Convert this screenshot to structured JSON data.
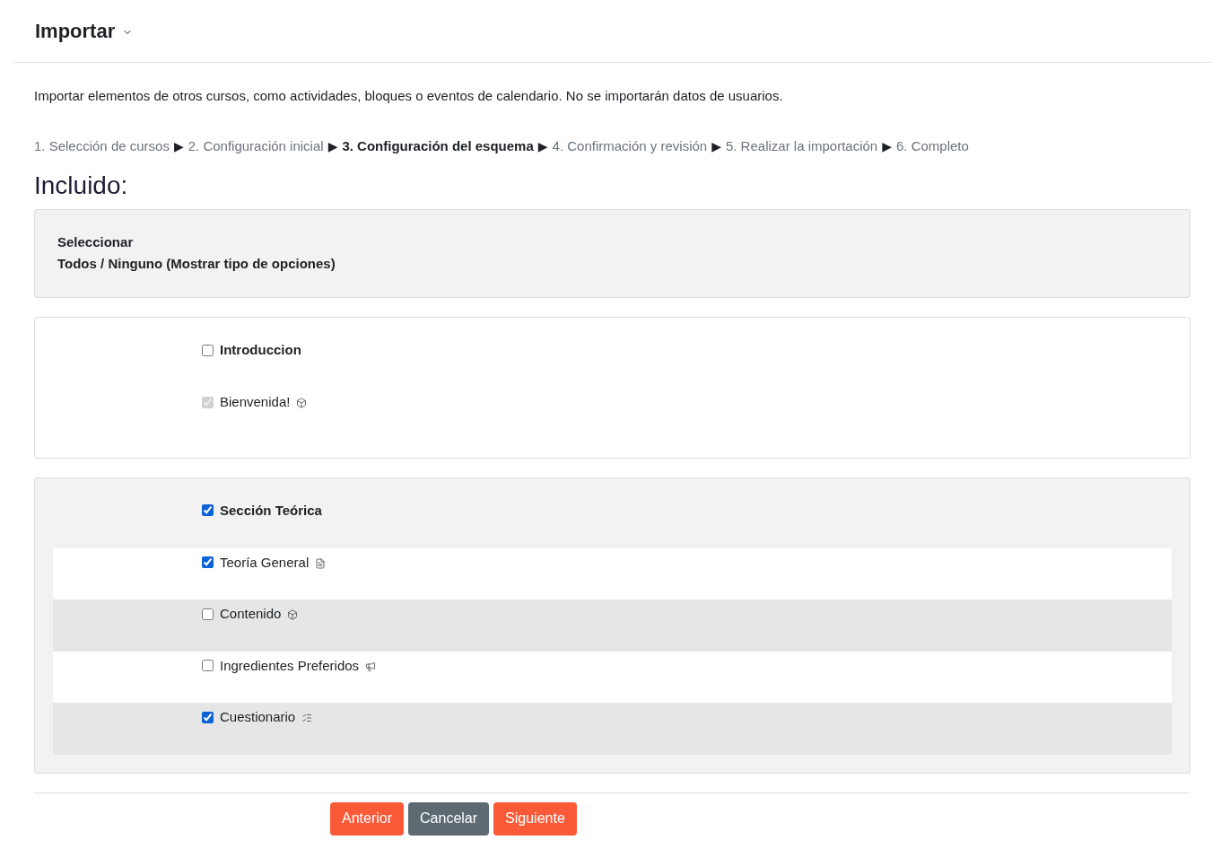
{
  "header": {
    "title": "Importar"
  },
  "description": "Importar elementos de otros cursos, como actividades, bloques o eventos de calendario. No se importarán datos de usuarios.",
  "steps": {
    "items": [
      {
        "label": "1. Selección de cursos",
        "current": false,
        "separator": "▶"
      },
      {
        "label": "2. Configuración inicial",
        "current": false,
        "separator": "▶"
      },
      {
        "label": "3. Configuración del esquema",
        "current": true,
        "separator": "▶"
      },
      {
        "label": "4. Confirmación y revisión",
        "current": false,
        "separator": "▶"
      },
      {
        "label": "5. Realizar la importación",
        "current": false,
        "separator": "▶"
      },
      {
        "label": "6. Completo",
        "current": false
      }
    ]
  },
  "heading": "Incluido:",
  "select_panel": {
    "label": "Seleccionar",
    "options": "Todos / Ninguno (Mostrar tipo de opciones)"
  },
  "sections": [
    {
      "title": "Introduccion",
      "checked": false,
      "items": [
        {
          "label": "Bienvenida!",
          "kind": "package",
          "checked": true,
          "disabled": true
        }
      ]
    },
    {
      "title": "Sección Teórica",
      "checked": true,
      "items": [
        {
          "label": "Teoría General",
          "kind": "page",
          "checked": true,
          "disabled": false
        },
        {
          "label": "Contenido",
          "kind": "package",
          "checked": false,
          "disabled": false
        },
        {
          "label": "Ingredientes Preferidos",
          "kind": "forum",
          "checked": false,
          "disabled": false
        },
        {
          "label": "Cuestionario",
          "kind": "quiz",
          "checked": true,
          "disabled": false
        }
      ]
    }
  ],
  "buttons": [
    {
      "label": "Anterior",
      "kind": "primary"
    },
    {
      "label": "Cancelar",
      "kind": "secondary"
    },
    {
      "label": "Siguiente",
      "kind": "primary"
    }
  ]
}
